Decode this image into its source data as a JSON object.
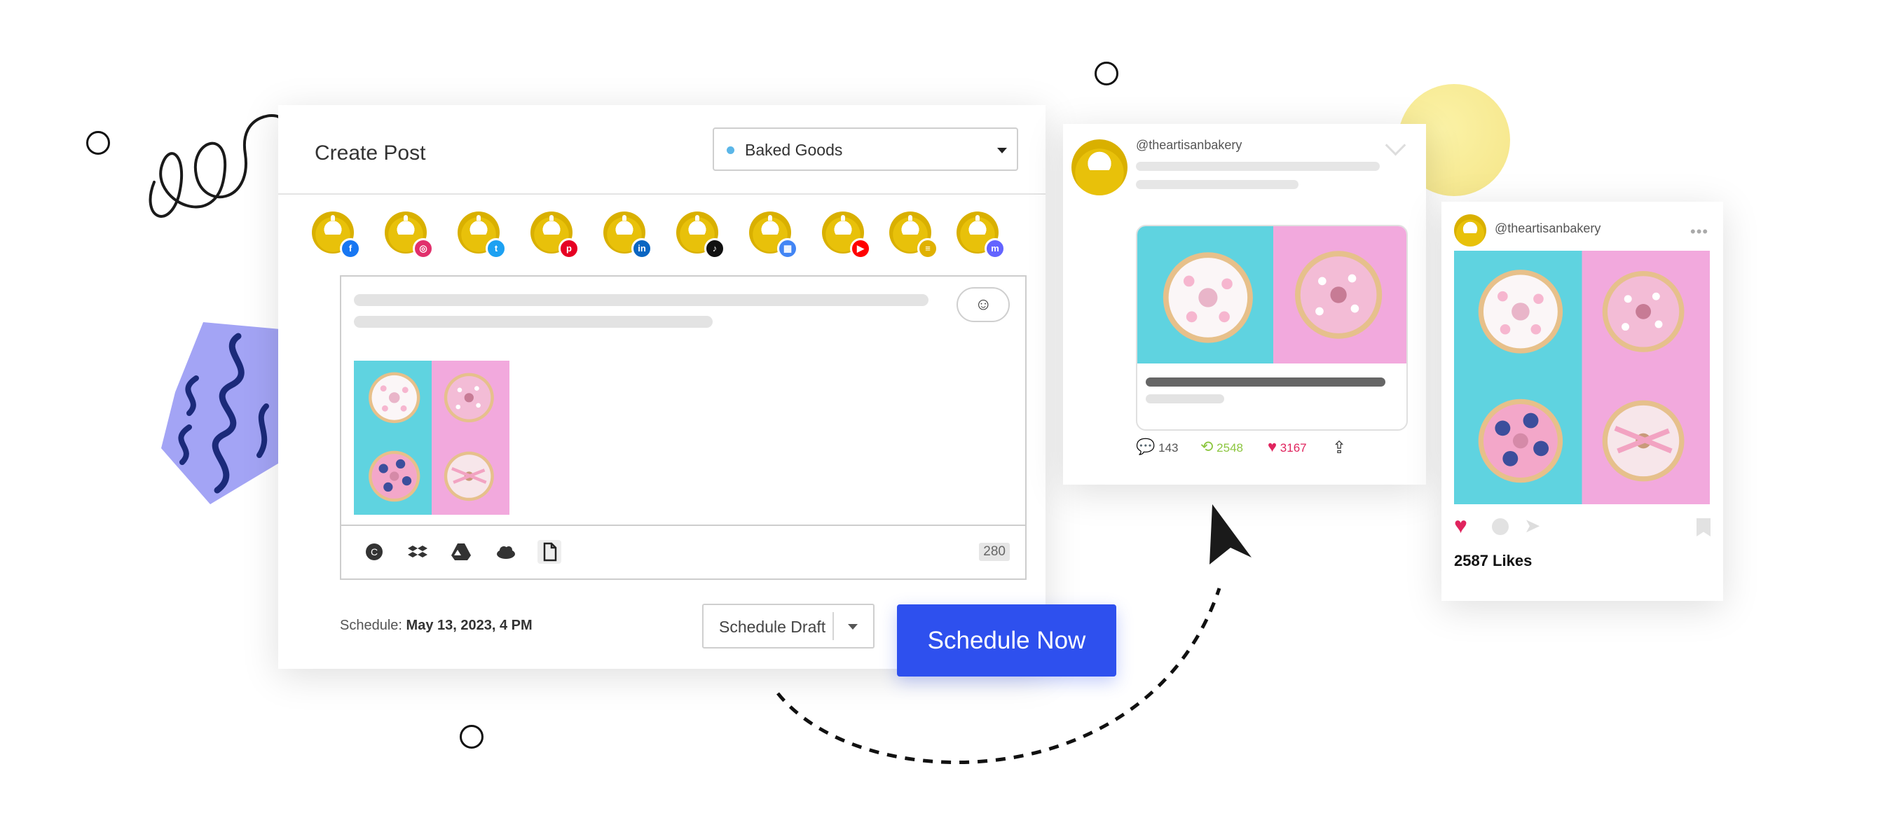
{
  "create_post": {
    "title": "Create Post",
    "group_select": {
      "value": "Baked Goods",
      "dot_color": "#5bb6e8"
    },
    "profiles": [
      {
        "network": "facebook",
        "icon": "f",
        "color": "#1877f2"
      },
      {
        "network": "instagram",
        "icon": "◎",
        "color": "#e1306c"
      },
      {
        "network": "twitter",
        "icon": "t",
        "color": "#1da1f2"
      },
      {
        "network": "pinterest",
        "icon": "p",
        "color": "#e60023"
      },
      {
        "network": "linkedin",
        "icon": "in",
        "color": "#0a66c2"
      },
      {
        "network": "tiktok",
        "icon": "♪",
        "color": "#111111"
      },
      {
        "network": "google-business",
        "icon": "▦",
        "color": "#4285f4"
      },
      {
        "network": "youtube",
        "icon": "▶",
        "color": "#ff0000"
      },
      {
        "network": "blog",
        "icon": "≡",
        "color": "#e0b100"
      },
      {
        "network": "mastodon",
        "icon": "m",
        "color": "#6364ff"
      }
    ],
    "toolbar_icons": [
      "canva-icon",
      "dropbox-icon",
      "google-drive-icon",
      "onedrive-icon",
      "file-icon"
    ],
    "char_count": "280",
    "schedule_label": "Schedule:",
    "schedule_value": "May 13, 2023, 4 PM",
    "draft_button": "Schedule Draft",
    "now_button": "Schedule Now",
    "accent_color": "#2e50ee"
  },
  "twitter_preview": {
    "handle": "@theartisanbakery",
    "replies": "143",
    "retweets": "2548",
    "likes": "3167",
    "retweet_color": "#8cc63f",
    "like_color": "#e0245e"
  },
  "instagram_preview": {
    "handle": "@theartisanbakery",
    "likes_text": "2587 Likes"
  }
}
